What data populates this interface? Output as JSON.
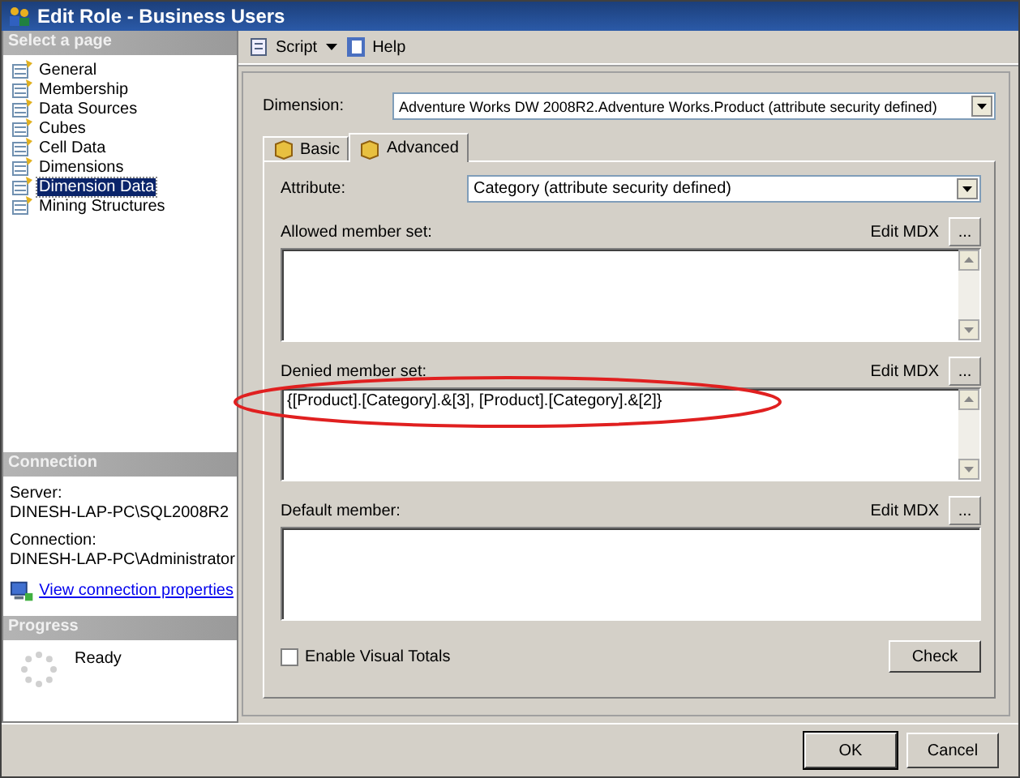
{
  "window": {
    "title": "Edit Role - Business Users"
  },
  "sidebar": {
    "header": "Select a page",
    "items": [
      {
        "label": "General",
        "selected": false
      },
      {
        "label": "Membership",
        "selected": false
      },
      {
        "label": "Data Sources",
        "selected": false
      },
      {
        "label": "Cubes",
        "selected": false
      },
      {
        "label": "Cell Data",
        "selected": false
      },
      {
        "label": "Dimensions",
        "selected": false
      },
      {
        "label": "Dimension Data",
        "selected": true
      },
      {
        "label": "Mining Structures",
        "selected": false
      }
    ]
  },
  "connection": {
    "header": "Connection",
    "server_label": "Server:",
    "server": "DINESH-LAP-PC\\SQL2008R2",
    "connection_label": "Connection:",
    "connection": "DINESH-LAP-PC\\Administrator",
    "link": "View connection properties"
  },
  "progress": {
    "header": "Progress",
    "status": "Ready"
  },
  "toolbar": {
    "script": "Script",
    "help": "Help"
  },
  "dimension": {
    "label": "Dimension:",
    "value": "Adventure Works DW 2008R2.Adventure Works.Product (attribute security defined)"
  },
  "tabs": [
    {
      "label": "Basic",
      "selected": false
    },
    {
      "label": "Advanced",
      "selected": true
    }
  ],
  "attribute": {
    "label": "Attribute:",
    "value": "Category (attribute security defined)"
  },
  "member_sets": [
    {
      "label": "Allowed member set:",
      "button": "Edit MDX",
      "more": "...",
      "scrollbar": true,
      "highlighted": false
    },
    {
      "label": "Denied member set:",
      "button": "Edit MDX",
      "more": "...",
      "value": "{[Product].[Category].&[3], [Product].[Category].&[2]}",
      "scrollbar": true,
      "highlighted": true
    },
    {
      "label": "Default member:",
      "button": "Edit MDX",
      "more": "...",
      "scrollbar": false,
      "highlighted": false
    }
  ],
  "visual_totals": {
    "label": "Enable Visual Totals",
    "checked": false
  },
  "check_button": "Check",
  "buttons": [
    "OK",
    "Cancel"
  ]
}
